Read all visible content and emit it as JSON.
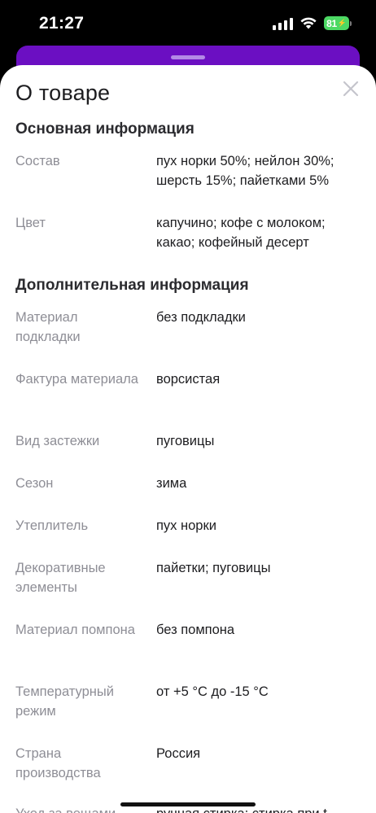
{
  "status": {
    "time": "21:27",
    "battery": "81"
  },
  "sheet": {
    "title": "О товаре"
  },
  "sections": [
    {
      "title": "Основная информация",
      "rows": [
        {
          "label": "Состав",
          "value": "пух норки 50%; нейлон 30%; шерсть 15%; пайетками 5%"
        },
        {
          "label": "Цвет",
          "value": "капучино; кофе с молоком; какао; кофейный десерт"
        }
      ]
    },
    {
      "title": "Дополнительная информация",
      "rows": [
        {
          "label": "Материал подкладки",
          "value": "без подкладки"
        },
        {
          "label": "Фактура материала",
          "value": "ворсистая"
        },
        {
          "label": "Вид застежки",
          "value": "пуговицы"
        },
        {
          "label": "Сезон",
          "value": "зима"
        },
        {
          "label": "Утеплитель",
          "value": "пух норки"
        },
        {
          "label": "Декоративные элементы",
          "value": "пайетки; пуговицы"
        },
        {
          "label": "Материал помпона",
          "value": "без помпона"
        },
        {
          "label": "Температурный режим",
          "value": "от +5 °C до -15 °C"
        },
        {
          "label": "Страна производства",
          "value": "Россия"
        },
        {
          "label": "Уход за вещами",
          "value": "ручная стирка; стирка при t"
        }
      ]
    }
  ]
}
